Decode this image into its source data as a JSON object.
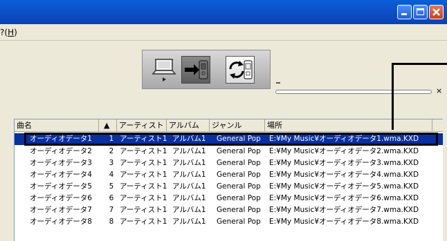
{
  "menubar": {
    "items": [
      {
        "label_prefix": "?(",
        "label_accel": "H",
        "label_suffix": ")"
      }
    ]
  },
  "toolbar": {
    "icons": [
      "computer-icon",
      "transfer-to-player-icon",
      "sync-icon"
    ],
    "progress": {
      "dash": "-",
      "close": "×"
    }
  },
  "table": {
    "headers": [
      "曲名",
      "▲",
      "アーティスト",
      "アルバム",
      "ジャンル",
      "場所"
    ],
    "rows": [
      {
        "title": "オーディオデータ1",
        "no": "1",
        "artist": "アーティスト1",
        "album": "アルバム1",
        "genre": "General Pop",
        "path": "E:¥My Music¥オーディオデータ1.wma.KXD"
      },
      {
        "title": "オーディオデータ2",
        "no": "2",
        "artist": "アーティスト1",
        "album": "アルバム1",
        "genre": "General Pop",
        "path": "E:¥My Music¥オーディオデータ2.wma.KXD"
      },
      {
        "title": "オーディオデータ3",
        "no": "3",
        "artist": "アーティスト1",
        "album": "アルバム1",
        "genre": "General Pop",
        "path": "E:¥My Music¥オーディオデータ3.wma.KXD"
      },
      {
        "title": "オーディオデータ4",
        "no": "4",
        "artist": "アーティスト1",
        "album": "アルバム1",
        "genre": "General Pop",
        "path": "E:¥My Music¥オーディオデータ4.wma.KXD"
      },
      {
        "title": "オーディオデータ5",
        "no": "5",
        "artist": "アーティスト1",
        "album": "アルバム1",
        "genre": "General Pop",
        "path": "E:¥My Music¥オーディオデータ5.wma.KXD"
      },
      {
        "title": "オーディオデータ6",
        "no": "6",
        "artist": "アーティスト1",
        "album": "アルバム1",
        "genre": "General Pop",
        "path": "E:¥My Music¥オーディオデータ6.wma.KXD"
      },
      {
        "title": "オーディオデータ7",
        "no": "7",
        "artist": "アーティスト1",
        "album": "アルバム1",
        "genre": "General Pop",
        "path": "E:¥My Music¥オーディオデータ7.wma.KXD"
      },
      {
        "title": "オーディオデータ8",
        "no": "8",
        "artist": "アーティスト1",
        "album": "アルバム1",
        "genre": "General Pop",
        "path": "E:¥My Music¥オーディオデータ8.wma.KXD"
      }
    ],
    "selected_index": 0
  },
  "colors": {
    "selection": "#0a2f9e",
    "titlebar": "#0a5fd8",
    "window_bg": "#ece9d8"
  }
}
